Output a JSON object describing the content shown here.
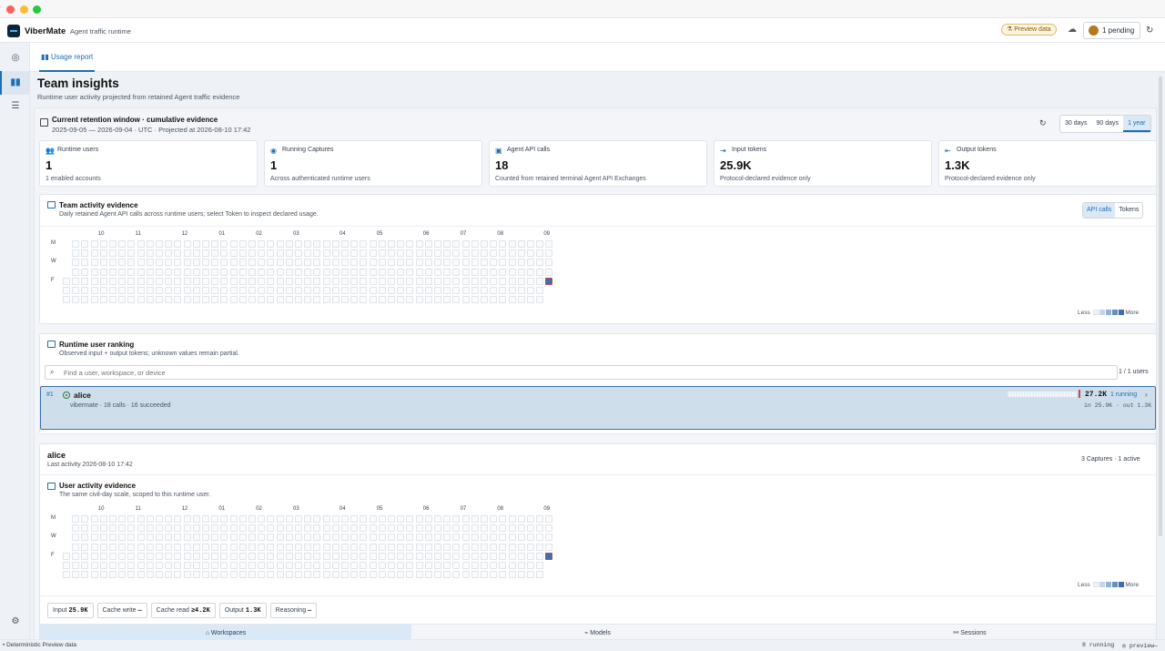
{
  "app": {
    "name": "ViberMate",
    "subtitle": "Agent traffic runtime",
    "preview_pill": "⚗ Preview data",
    "pending": "1 pending"
  },
  "tabs": {
    "usage": "Usage report"
  },
  "page": {
    "title": "Team insights",
    "subtitle": "Runtime user activity projected from retained Agent traffic evidence"
  },
  "retention": {
    "title": "Current retention window · cumulative evidence",
    "range": "2025-09-05 — 2026-09-04 · UTC · Projected at 2026-08-10 17:42",
    "ranges": [
      "30 days",
      "90 days",
      "1 year"
    ],
    "selected_range": "1 year"
  },
  "metrics": [
    {
      "label": "Runtime users",
      "value": "1",
      "sub": "1 enabled accounts",
      "icon": "users-icon"
    },
    {
      "label": "Running Captures",
      "value": "1",
      "sub": "Across authenticated runtime users",
      "icon": "signal-icon"
    },
    {
      "label": "Agent API calls",
      "value": "18",
      "sub": "Counted from retained terminal Agent API Exchanges",
      "icon": "chat-icon"
    },
    {
      "label": "Input tokens",
      "value": "25.9K",
      "sub": "Protocol-declared evidence only",
      "icon": "input-icon"
    },
    {
      "label": "Output tokens",
      "value": "1.3K",
      "sub": "Protocol-declared evidence only",
      "icon": "output-icon"
    }
  ],
  "team_activity": {
    "title": "Team activity evidence",
    "subtitle": "Daily retained Agent API calls across runtime users; select Token to inspect declared usage.",
    "toggle": [
      "API calls",
      "Tokens"
    ],
    "selected": "API calls"
  },
  "heatmap": {
    "months": [
      "10",
      "11",
      "12",
      "01",
      "02",
      "03",
      "04",
      "05",
      "06",
      "07",
      "08",
      "09"
    ],
    "days": [
      "M",
      "W",
      "F"
    ],
    "legend_less": "Less",
    "legend_more": "More",
    "active_cells": [
      {
        "week": 52,
        "day": 4,
        "level": 4
      }
    ]
  },
  "ranking": {
    "title": "Runtime user ranking",
    "subtitle": "Observed input + output tokens; unknown values remain partial.",
    "search_placeholder": "Find a user, workspace, or device",
    "search_value": "",
    "count": "1 / 1 users",
    "rows": [
      {
        "rank": "#1",
        "name": "alice",
        "meta": "vibermate · 18 calls · 16 succeeded",
        "total": "27.2K",
        "running": "1 running",
        "io": "in 25.9K · out 1.3K"
      }
    ]
  },
  "user_detail": {
    "name": "alice",
    "last_activity": "Last activity 2026-08-10 17:42",
    "captures": "3 Captures · 1 active",
    "activity_title": "User activity evidence",
    "activity_subtitle": "The same civil-day scale, scoped to this runtime user.",
    "chips": [
      {
        "label": "Input",
        "value": "25.9K"
      },
      {
        "label": "Cache write",
        "value": "—"
      },
      {
        "label": "Cache read",
        "value": "≥4.2K"
      },
      {
        "label": "Output",
        "value": "1.3K"
      },
      {
        "label": "Reasoning",
        "value": "—"
      }
    ],
    "subtabs": [
      "Workspaces",
      "Models",
      "Sessions"
    ],
    "selected_subtab": "Workspaces"
  },
  "status": {
    "left": "• Deterministic Preview data",
    "running": "8 running",
    "preview": "◎ preview—"
  },
  "colors": {
    "accent": "#1d6fb8",
    "heat_on": "#3b6fb0",
    "selected_row": "#cfdeeb"
  }
}
